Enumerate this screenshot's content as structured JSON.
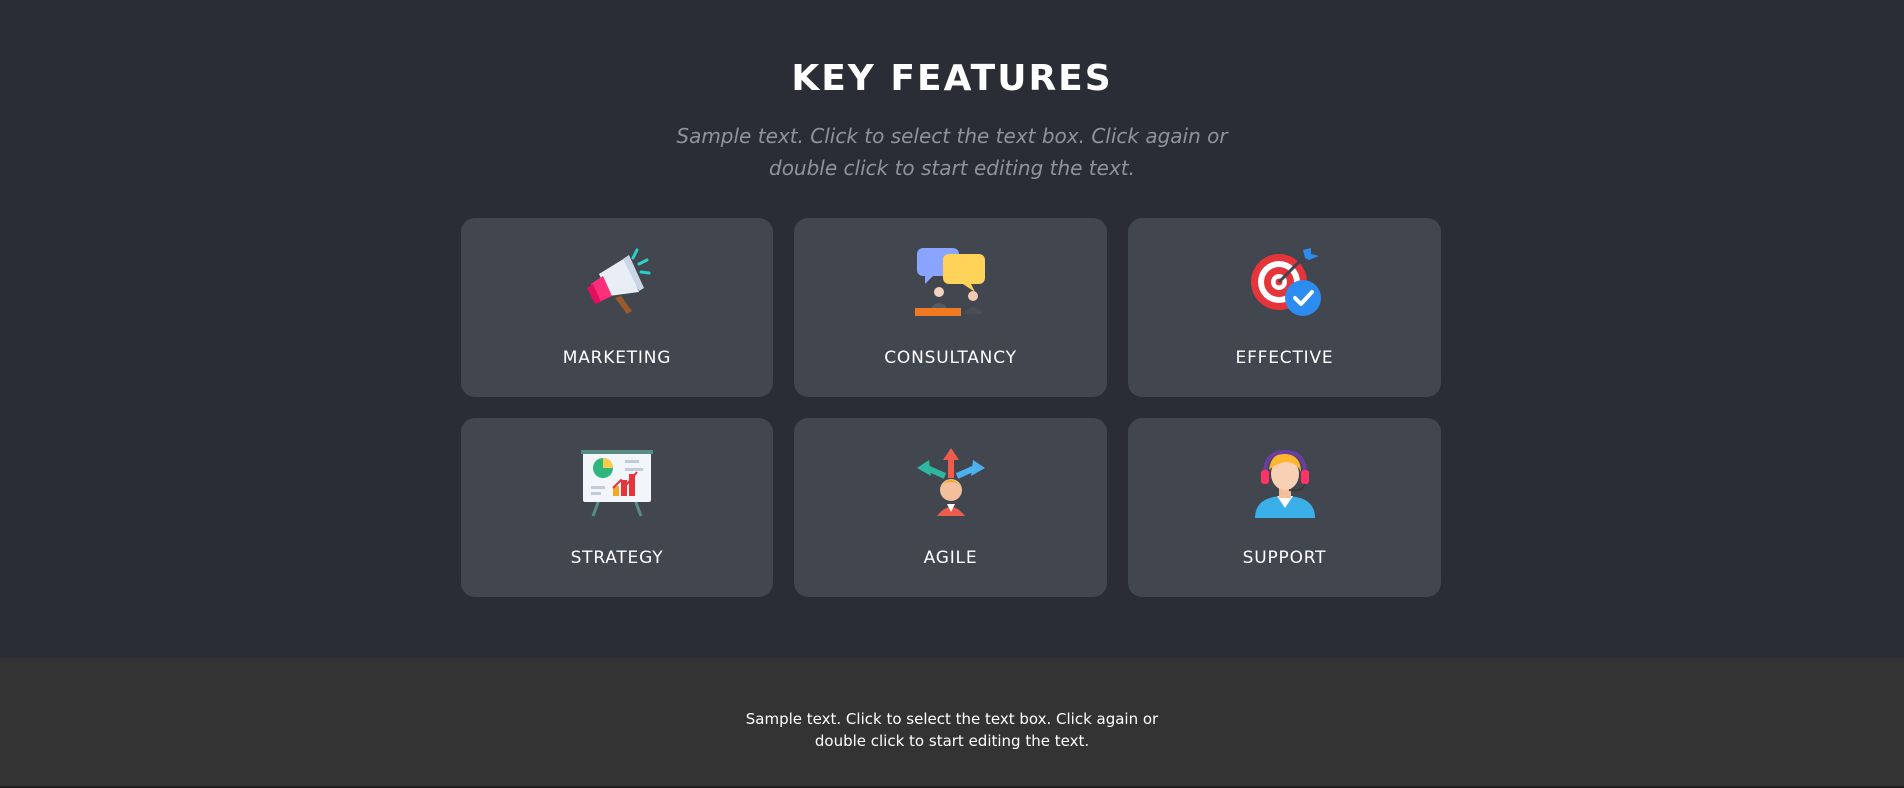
{
  "section": {
    "title": "KEY FEATURES",
    "subtitle": "Sample text. Click to select the text box. Click again or double click to start editing the text."
  },
  "cards": [
    {
      "label": "MARKETING",
      "icon": "megaphone-icon"
    },
    {
      "label": "CONSULTANCY",
      "icon": "consultancy-chat-icon"
    },
    {
      "label": "EFFECTIVE",
      "icon": "target-check-icon"
    },
    {
      "label": "STRATEGY",
      "icon": "presentation-board-icon"
    },
    {
      "label": "AGILE",
      "icon": "agile-arrows-person-icon"
    },
    {
      "label": "SUPPORT",
      "icon": "support-headset-icon"
    }
  ],
  "footer": {
    "text": "Sample text. Click to select the text box. Click again or double click to start editing the text."
  },
  "colors": {
    "background": "#2a2d35",
    "card": "#41464f",
    "footer": "#333333",
    "subtitle": "#8e939d"
  }
}
